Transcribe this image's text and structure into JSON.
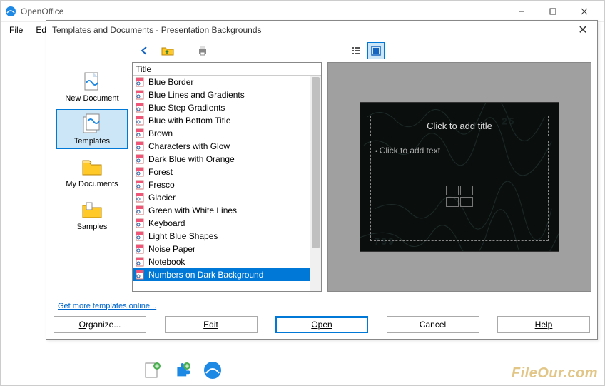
{
  "app": {
    "title": "OpenOffice",
    "menubar": [
      "File",
      "Edit"
    ]
  },
  "dialog": {
    "title": "Templates and Documents - Presentation Backgrounds",
    "toolbar": {
      "back": "back-icon",
      "up": "folder-up-icon",
      "print": "print-icon",
      "view_list": "list-view-icon",
      "view_preview": "preview-view-icon"
    },
    "sidebar": {
      "items": [
        {
          "key": "new-document",
          "label": "New Document",
          "selected": false
        },
        {
          "key": "templates",
          "label": "Templates",
          "selected": true
        },
        {
          "key": "my-documents",
          "label": "My Documents",
          "selected": false
        },
        {
          "key": "samples",
          "label": "Samples",
          "selected": false
        }
      ]
    },
    "list": {
      "header": "Title",
      "items": [
        "Blue Border",
        "Blue Lines and Gradients",
        "Blue Step Gradients",
        "Blue with Bottom Title",
        "Brown",
        "Characters with Glow",
        "Dark Blue with Orange",
        "Forest",
        "Fresco",
        "Glacier",
        "Green with White Lines",
        "Keyboard",
        "Light Blue Shapes",
        "Noise Paper",
        "Notebook",
        "Numbers on Dark Background"
      ],
      "selected_index": 15
    },
    "preview": {
      "title_placeholder": "Click to add title",
      "body_placeholder": "Click to add text"
    },
    "link": "Get more templates online...",
    "buttons": {
      "organize": "Organize...",
      "edit": "Edit",
      "open": "Open",
      "cancel": "Cancel",
      "help": "Help"
    }
  },
  "watermark": "FileOur.com"
}
